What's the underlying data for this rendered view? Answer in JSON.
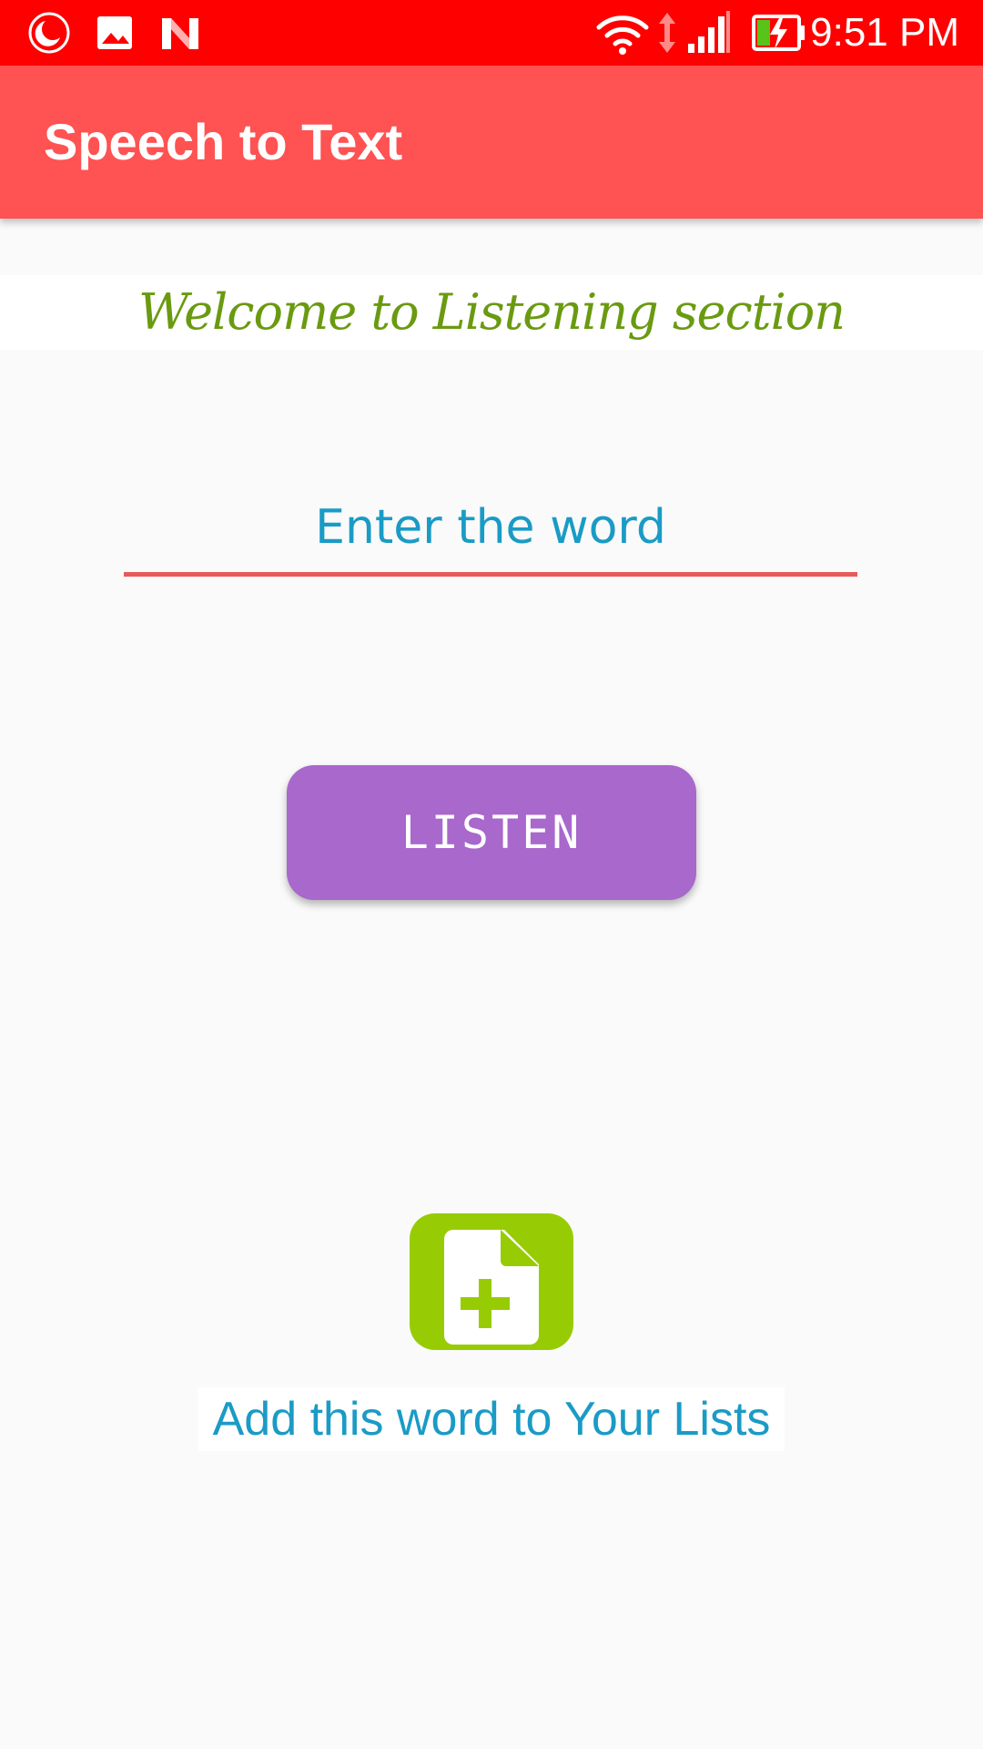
{
  "status_bar": {
    "time": "9:51 PM",
    "background_color": "#ff0000",
    "icons": [
      "night-mode-icon",
      "image-notification-icon",
      "n-notification-icon",
      "wifi-icon",
      "data-arrows-icon",
      "cell-signal-icon",
      "battery-charging-icon"
    ]
  },
  "app_bar": {
    "title": "Speech to Text",
    "background_color": "#ff5252"
  },
  "welcome": {
    "text": "Welcome to Listening section",
    "color": "#6a9a10"
  },
  "word_input": {
    "value": "",
    "placeholder": "Enter the word",
    "underline_color": "#e85a5a"
  },
  "listen_button": {
    "label": "LISTEN",
    "color": "#a868cc"
  },
  "add_to_list": {
    "icon": "add-document-icon",
    "icon_color": "#97cc04",
    "label": "Add this word to Your Lists",
    "label_color": "#1a9bc6"
  }
}
